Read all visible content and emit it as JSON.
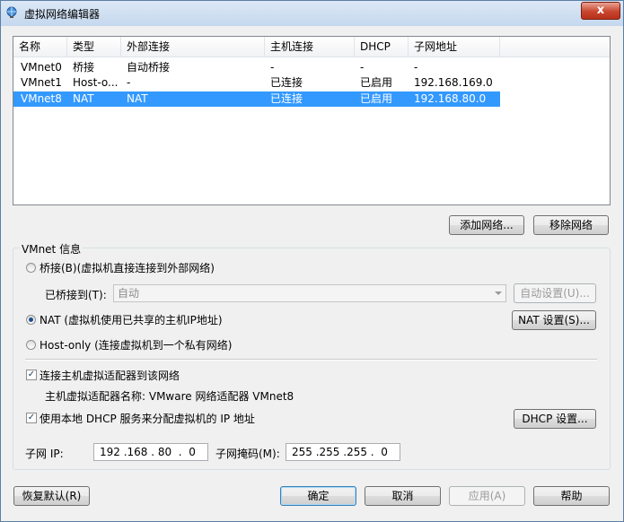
{
  "window": {
    "title": "虚拟网络编辑器",
    "close_label": "x"
  },
  "table": {
    "headers": [
      "名称",
      "类型",
      "外部连接",
      "主机连接",
      "DHCP",
      "子网地址"
    ],
    "rows": [
      {
        "name": "VMnet0",
        "type": "桥接",
        "external": "自动桥接",
        "host": "-",
        "dhcp": "-",
        "subnet": "-",
        "selected": false
      },
      {
        "name": "VMnet1",
        "type": "Host-o...",
        "external": "-",
        "host": "已连接",
        "dhcp": "已启用",
        "subnet": "192.168.169.0",
        "selected": false
      },
      {
        "name": "VMnet8",
        "type": "NAT",
        "external": "NAT",
        "host": "已连接",
        "dhcp": "已启用",
        "subnet": "192.168.80.0",
        "selected": true
      }
    ],
    "selection_color": "#3399ff"
  },
  "net_buttons": {
    "add": "添加网络...",
    "remove": "移除网络"
  },
  "vmnet_info": {
    "legend": "VMnet 信息",
    "bridged_label": "桥接(B)(虚拟机直接连接到外部网络)",
    "bridged_to_label": "已桥接到(T):",
    "bridged_to_value": "自动",
    "auto_settings": "自动设置(U)...",
    "nat_label": "NAT (虚拟机使用已共享的主机IP地址)",
    "nat_settings": "NAT 设置(S)...",
    "hostonly_label": "Host-only (连接虚拟机到一个私有网络)",
    "selected_mode": "nat",
    "connect_adapter_label": "连接主机虚拟适配器到该网络",
    "connect_adapter_checked": true,
    "adapter_name_text": "主机虚拟适配器名称: VMware 网络适配器 VMnet8",
    "dhcp_label": "使用本地 DHCP 服务来分配虚拟机的 IP 地址",
    "dhcp_checked": true,
    "dhcp_settings": "DHCP 设置...",
    "subnet_ip_label": "子网 IP:",
    "subnet_ip_value": "192 .168 . 80  .  0",
    "subnet_mask_label": "子网掩码(M):",
    "subnet_mask_value": "255 .255 .255 .  0"
  },
  "footer": {
    "restore": "恢复默认(R)",
    "ok": "确定",
    "cancel": "取消",
    "apply": "应用(A)",
    "help": "帮助"
  }
}
